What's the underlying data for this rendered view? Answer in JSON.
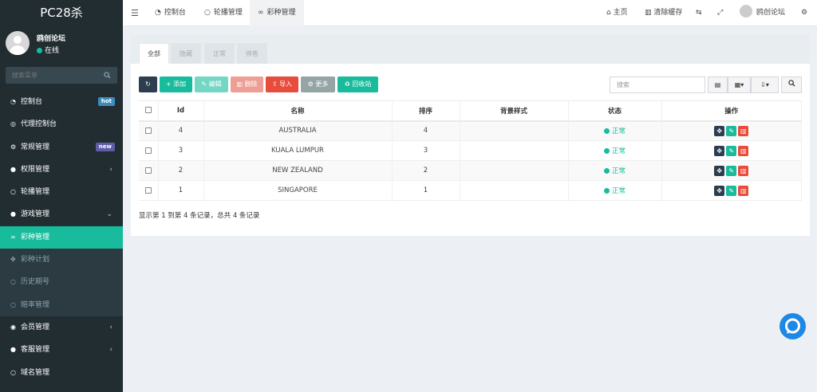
{
  "brand": {
    "title": "PC28杀"
  },
  "user": {
    "name": "鸥创论坛",
    "status": "在线"
  },
  "sidebar_search": {
    "placeholder": "搜索菜单"
  },
  "menu": [
    {
      "label": "控制台",
      "icon": "dashboard-icon",
      "badge": "hot"
    },
    {
      "label": "代理控制台",
      "icon": "globe-icon"
    },
    {
      "label": "常规管理",
      "icon": "cogs-icon",
      "badge": "new"
    },
    {
      "label": "权限管理",
      "icon": "group-icon",
      "chevron": "‹"
    },
    {
      "label": "轮播管理",
      "icon": "circle-icon"
    },
    {
      "label": "游戏管理",
      "icon": "bomb-icon",
      "chevron": "⌄"
    },
    {
      "label": "彩种管理",
      "icon": "gamepad-icon",
      "active": true
    },
    {
      "label": "彩种计划",
      "icon": "rebel-icon",
      "sub": true
    },
    {
      "label": "历史期号",
      "icon": "circle-icon",
      "sub": true
    },
    {
      "label": "赔率管理",
      "icon": "circle-icon",
      "sub": true
    },
    {
      "label": "会员管理",
      "icon": "user-circle-icon",
      "chevron": "‹"
    },
    {
      "label": "客服管理",
      "icon": "comment-icon",
      "chevron": "‹"
    },
    {
      "label": "域名管理",
      "icon": "circle-icon"
    }
  ],
  "topbar": {
    "tabs": [
      "控制台",
      "轮播管理",
      "彩种管理"
    ],
    "home": "主页",
    "clear_cache": "清除缓存",
    "user": "鸥创论坛"
  },
  "panel_tabs": [
    "全部",
    "隐藏",
    "正常",
    "停售"
  ],
  "toolbar": {
    "add": "添加",
    "edit": "编辑",
    "delete": "删除",
    "import": "导入",
    "more": "更多",
    "recycle": "回收站",
    "search_placeholder": "搜索"
  },
  "table": {
    "headers": [
      "Id",
      "名称",
      "排序",
      "背景样式",
      "状态",
      "操作"
    ],
    "rows": [
      {
        "id": "4",
        "name": "AUSTRALIA",
        "sort": "4",
        "bg": "",
        "status": "正常"
      },
      {
        "id": "3",
        "name": "KUALA LUMPUR",
        "sort": "3",
        "bg": "",
        "status": "正常"
      },
      {
        "id": "2",
        "name": "NEW ZEALAND",
        "sort": "2",
        "bg": "",
        "status": "正常"
      },
      {
        "id": "1",
        "name": "SINGAPORE",
        "sort": "1",
        "bg": "",
        "status": "正常"
      }
    ]
  },
  "pager": "显示第 1 到第 4 条记录，总共 4 条记录",
  "colors": {
    "accent": "#18bc9c",
    "sidebar": "#222d32",
    "danger": "#e74c3c",
    "dark": "#2c3e50"
  }
}
